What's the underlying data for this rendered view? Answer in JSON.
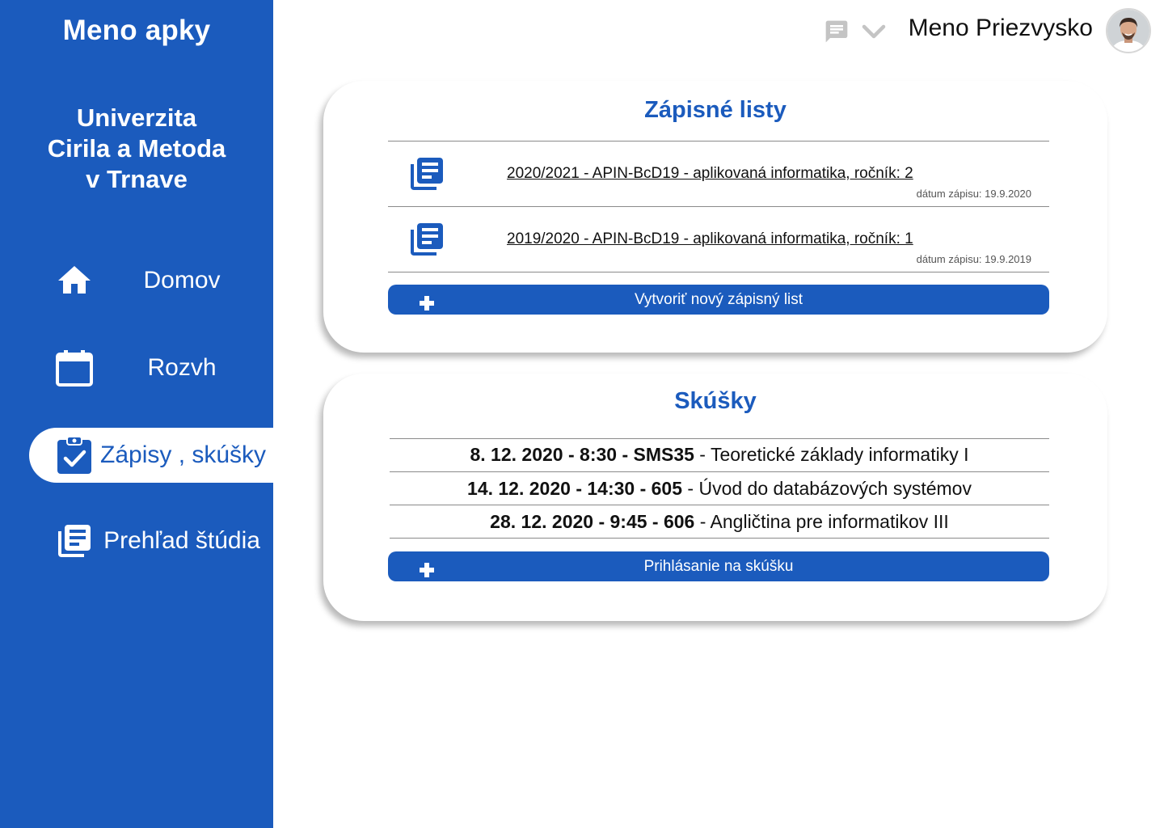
{
  "app": {
    "name": "Meno apky"
  },
  "university": {
    "line1": "Univerzita",
    "line2": "Cirila a Metoda",
    "line3": "v Trnave"
  },
  "nav": {
    "items": [
      {
        "label": "Domov",
        "icon": "home-icon"
      },
      {
        "label": "Rozvh",
        "icon": "calendar-icon"
      },
      {
        "label": "Zápisy , skúšky",
        "icon": "clipboard-check-icon",
        "active": true
      },
      {
        "label": "Prehľad štúdia",
        "icon": "library-books-icon"
      }
    ]
  },
  "header": {
    "user_name": "Meno Priezvysko"
  },
  "enrollment": {
    "title": "Zápisné listy",
    "sheets": [
      {
        "label": "2020/2021 - APIN-BcD19 - aplikovaná informatika, ročník: 2",
        "date": "dátum zápisu: 19.9.2020"
      },
      {
        "label": "2019/2020 - APIN-BcD19 - aplikovaná informatika, ročník: 1",
        "date": "dátum zápisu: 19.9.2019"
      }
    ],
    "button_label": "Vytvoriť nový zápisný list"
  },
  "exams": {
    "title": "Skúšky",
    "items": [
      {
        "head": "8. 12. 2020 - 8:30 - SMS35",
        "course": " - Teoretické základy informatiky I"
      },
      {
        "head": "14. 12. 2020 - 14:30 - 605",
        "course": " - Úvod do databázových systémov"
      },
      {
        "head": "28. 12. 2020 - 9:45 - 606",
        "course": " - Angličtina pre informatikov III"
      }
    ],
    "button_label": "Prihlásanie na skúšku"
  },
  "colors": {
    "primary": "#1b5bbd",
    "background": "#ffffff",
    "header_icons": "#c4c4c4"
  }
}
